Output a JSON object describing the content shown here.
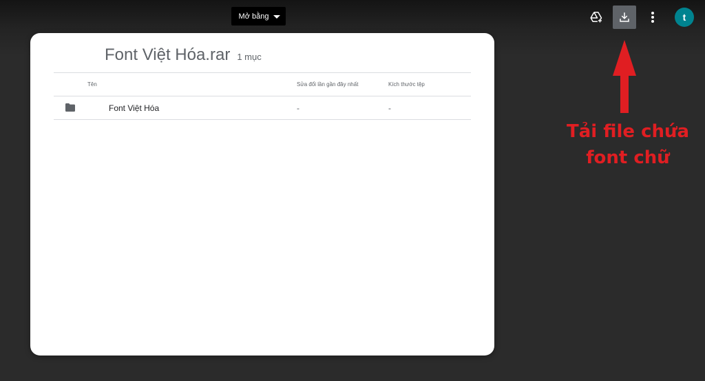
{
  "toolbar": {
    "open_with_label": "Mở bằng",
    "icons": [
      "add-to-drive-icon",
      "download-icon",
      "more-vert-icon"
    ],
    "avatar_letter": "t",
    "avatar_color": "#00838f"
  },
  "file": {
    "title": "Font Việt Hóa.rar",
    "count": "1 mục"
  },
  "table": {
    "headers": {
      "name": "Tên",
      "modified": "Sửa đổi lần gần đây nhất",
      "size": "Kích thước tệp"
    },
    "rows": [
      {
        "icon": "folder-icon",
        "name": "Font Việt Hóa",
        "modified": "-",
        "size": "-"
      }
    ]
  },
  "annotation": {
    "line1": "Tải file chứa",
    "line2": "font chữ",
    "color": "#e01e22"
  }
}
